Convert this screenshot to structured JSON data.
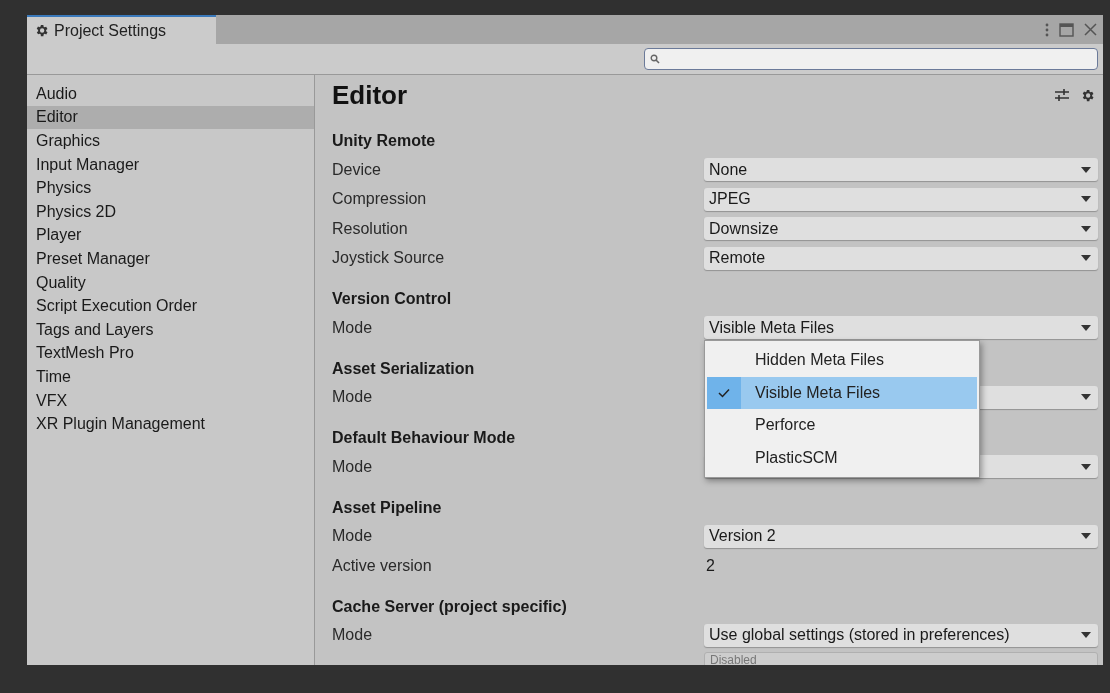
{
  "window": {
    "title": "Project Settings"
  },
  "sidebar": {
    "items": [
      {
        "label": "Audio",
        "selected": false
      },
      {
        "label": "Editor",
        "selected": true
      },
      {
        "label": "Graphics",
        "selected": false
      },
      {
        "label": "Input Manager",
        "selected": false
      },
      {
        "label": "Physics",
        "selected": false
      },
      {
        "label": "Physics 2D",
        "selected": false
      },
      {
        "label": "Player",
        "selected": false
      },
      {
        "label": "Preset Manager",
        "selected": false
      },
      {
        "label": "Quality",
        "selected": false
      },
      {
        "label": "Script Execution Order",
        "selected": false
      },
      {
        "label": "Tags and Layers",
        "selected": false
      },
      {
        "label": "TextMesh Pro",
        "selected": false
      },
      {
        "label": "Time",
        "selected": false
      },
      {
        "label": "VFX",
        "selected": false
      },
      {
        "label": "XR Plugin Management",
        "selected": false
      }
    ]
  },
  "content": {
    "title": "Editor",
    "sections": [
      {
        "heading": "Unity Remote",
        "rows": [
          {
            "label": "Device",
            "kind": "dropdown",
            "value": "None"
          },
          {
            "label": "Compression",
            "kind": "dropdown",
            "value": "JPEG"
          },
          {
            "label": "Resolution",
            "kind": "dropdown",
            "value": "Downsize"
          },
          {
            "label": "Joystick Source",
            "kind": "dropdown",
            "value": "Remote"
          }
        ]
      },
      {
        "heading": "Version Control",
        "rows": [
          {
            "label": "Mode",
            "kind": "dropdown",
            "value": "Visible Meta Files"
          }
        ]
      },
      {
        "heading": "Asset Serialization",
        "rows": [
          {
            "label": "Mode",
            "kind": "dropdown"
          }
        ]
      },
      {
        "heading": "Default Behaviour Mode",
        "rows": [
          {
            "label": "Mode",
            "kind": "dropdown"
          }
        ]
      },
      {
        "heading": "Asset Pipeline",
        "rows": [
          {
            "label": "Mode",
            "kind": "dropdown",
            "value": "Version 2"
          },
          {
            "label": "Active version",
            "kind": "text",
            "value": "2"
          }
        ]
      },
      {
        "heading": "Cache Server (project specific)",
        "rows": [
          {
            "label": "Mode",
            "kind": "dropdown",
            "value": "Use global settings (stored in preferences)"
          },
          {
            "kind": "field",
            "placeholder": "Disabled"
          }
        ]
      }
    ]
  },
  "popup": {
    "items": [
      {
        "label": "Hidden Meta Files",
        "selected": false
      },
      {
        "label": "Visible Meta Files",
        "selected": true
      },
      {
        "label": "Perforce",
        "selected": false
      },
      {
        "label": "PlasticSCM",
        "selected": false
      }
    ]
  }
}
